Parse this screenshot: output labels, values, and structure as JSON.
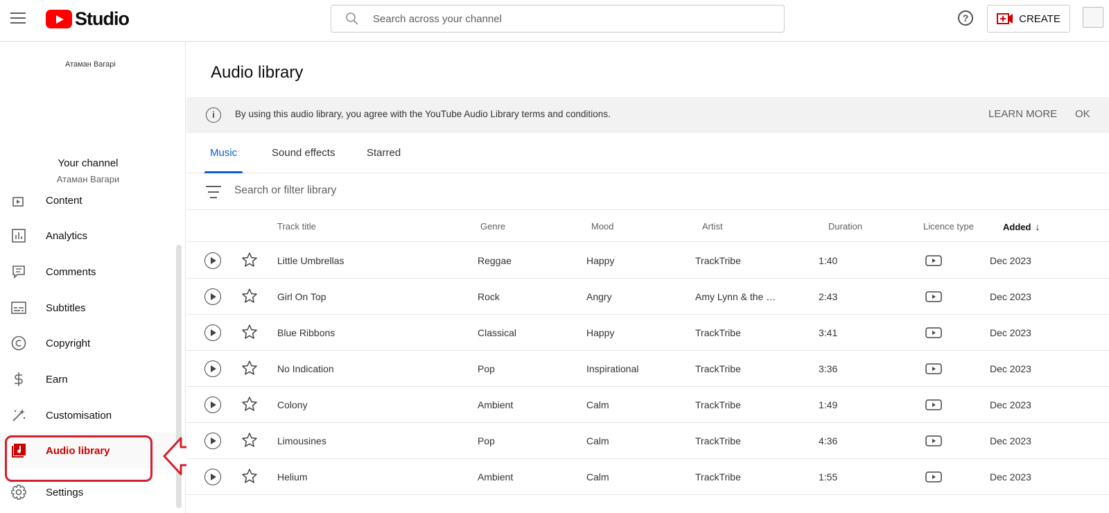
{
  "header": {
    "logo_text": "Studio",
    "search_placeholder": "Search across your channel",
    "help_icon": "?",
    "create_label": "CREATE"
  },
  "sidebar": {
    "channel_image_alt": "Атаман Вагарі",
    "channel_title": "Your channel",
    "channel_name": "Атаман Вагари",
    "items": [
      {
        "label": "Content",
        "icon": "content-icon"
      },
      {
        "label": "Analytics",
        "icon": "analytics-icon"
      },
      {
        "label": "Comments",
        "icon": "comments-icon"
      },
      {
        "label": "Subtitles",
        "icon": "subtitles-icon"
      },
      {
        "label": "Copyright",
        "icon": "copyright-icon"
      },
      {
        "label": "Earn",
        "icon": "earn-icon"
      },
      {
        "label": "Customisation",
        "icon": "customisation-icon"
      },
      {
        "label": "Audio library",
        "icon": "audio-library-icon",
        "active": true
      },
      {
        "label": "Settings",
        "icon": "settings-icon"
      }
    ]
  },
  "main": {
    "title": "Audio library",
    "notice": {
      "text": "By using this audio library, you agree with the YouTube Audio Library terms and conditions.",
      "learn_more": "LEARN MORE",
      "ok": "OK"
    },
    "tabs": [
      "Music",
      "Sound effects",
      "Starred"
    ],
    "active_tab": "Music",
    "filter_placeholder": "Search or filter library",
    "columns": {
      "title": "Track title",
      "genre": "Genre",
      "mood": "Mood",
      "artist": "Artist",
      "duration": "Duration",
      "licence": "Licence type",
      "added": "Added"
    },
    "tracks": [
      {
        "title": "Little Umbrellas",
        "genre": "Reggae",
        "mood": "Happy",
        "artist": "TrackTribe",
        "duration": "1:40",
        "added": "Dec 2023"
      },
      {
        "title": "Girl On Top",
        "genre": "Rock",
        "mood": "Angry",
        "artist": "Amy Lynn & the …",
        "duration": "2:43",
        "added": "Dec 2023"
      },
      {
        "title": "Blue Ribbons",
        "genre": "Classical",
        "mood": "Happy",
        "artist": "TrackTribe",
        "duration": "3:41",
        "added": "Dec 2023"
      },
      {
        "title": "No Indication",
        "genre": "Pop",
        "mood": "Inspirational",
        "artist": "TrackTribe",
        "duration": "3:36",
        "added": "Dec 2023"
      },
      {
        "title": "Colony",
        "genre": "Ambient",
        "mood": "Calm",
        "artist": "TrackTribe",
        "duration": "1:49",
        "added": "Dec 2023"
      },
      {
        "title": "Limousines",
        "genre": "Pop",
        "mood": "Calm",
        "artist": "TrackTribe",
        "duration": "4:36",
        "added": "Dec 2023"
      },
      {
        "title": "Helium",
        "genre": "Ambient",
        "mood": "Calm",
        "artist": "TrackTribe",
        "duration": "1:55",
        "added": "Dec 2023"
      }
    ]
  },
  "colors": {
    "brand_red": "#ff0000",
    "active_nav": "#cc0000",
    "tab_blue": "#065fd4",
    "annotation_red": "#d51f2c"
  }
}
